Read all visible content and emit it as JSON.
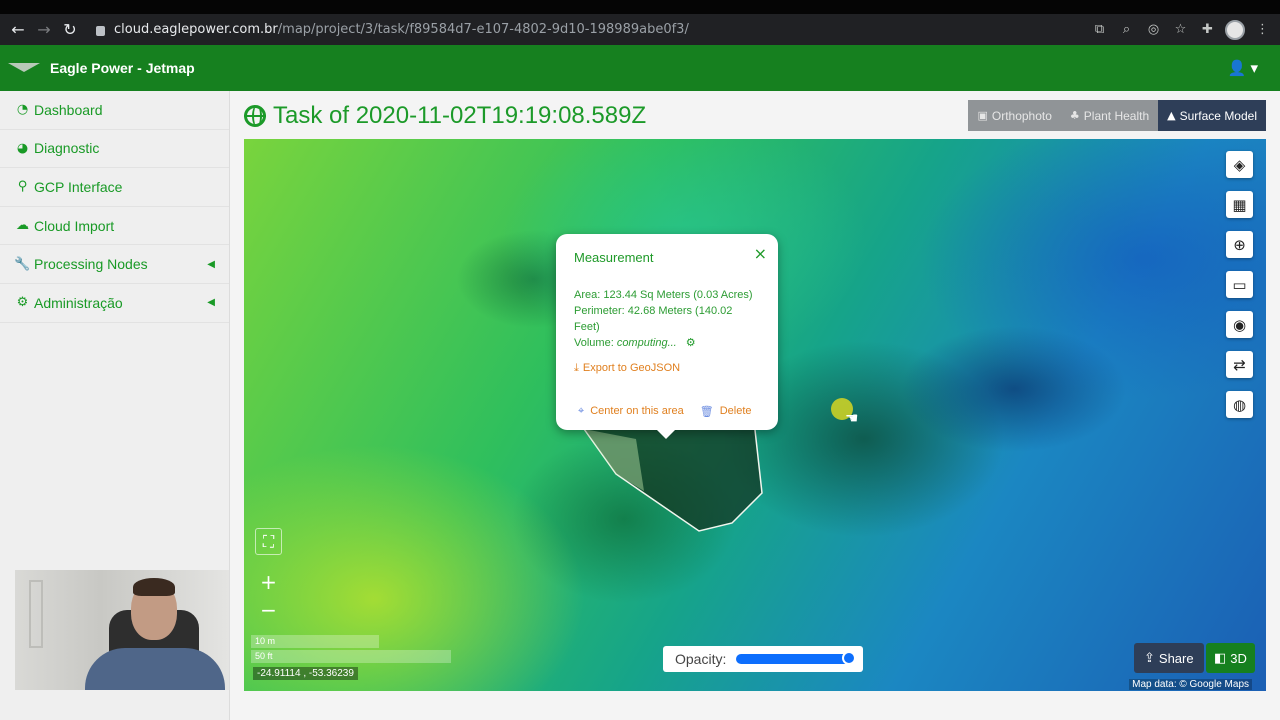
{
  "browser": {
    "url_host": "cloud.eaglepower.com.br",
    "url_path": "/map/project/3/task/f89584d7-e107-4802-9d10-198989abe0f3/"
  },
  "app": {
    "brand": "Eagle Power - Jetmap"
  },
  "sidebar": {
    "items": [
      {
        "label": "Dashboard",
        "icon": "dashboard-icon"
      },
      {
        "label": "Diagnostic",
        "icon": "pie-chart-icon"
      },
      {
        "label": "GCP Interface",
        "icon": "map-marker-icon"
      },
      {
        "label": "Cloud Import",
        "icon": "cloud-upload-icon"
      },
      {
        "label": "Processing Nodes",
        "icon": "wrench-icon"
      },
      {
        "label": "Administração",
        "icon": "gears-icon"
      }
    ]
  },
  "main": {
    "title": "Task of 2020-11-02T19:19:08.589Z",
    "tabs": [
      {
        "label": "Orthophoto",
        "icon": "image-icon"
      },
      {
        "label": "Plant Health",
        "icon": "plant-icon"
      },
      {
        "label": "Surface Model",
        "icon": "area-chart-icon"
      }
    ]
  },
  "map": {
    "scale_m": "10 m",
    "scale_ft": "50 ft",
    "coords": "-24.91114 , -53.36239",
    "opacity_label": "Opacity:",
    "opacity_value": 1.0,
    "share_label": "Share",
    "three_d_label": "3D",
    "attribution": "Map data: © Google Maps"
  },
  "popup": {
    "title": "Measurement",
    "area": "Area: 123.44 Sq Meters (0.03 Acres)",
    "perimeter_1": "Perimeter: 42.68 Meters (140.02",
    "perimeter_2": "Feet)",
    "volume_label": "Volume:",
    "volume_value": "computing...",
    "export": "Export to GeoJSON",
    "center": "Center on this area",
    "delete": "Delete"
  },
  "colors": {
    "brand_green": "#16801f",
    "active_tab": "#2e3e58",
    "accent_orange": "#e08020"
  }
}
